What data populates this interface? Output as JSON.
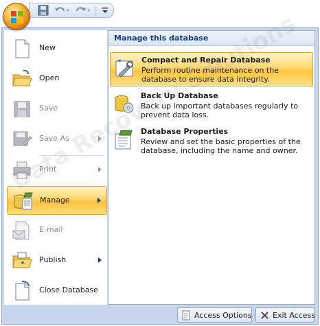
{
  "toolbar": {
    "icons": [
      "office-button-icon",
      "save-icon",
      "undo-icon",
      "redo-icon",
      "customize-icon"
    ]
  },
  "left_menu": {
    "items": [
      {
        "label": "New",
        "enabled": true,
        "has_submenu": false,
        "icon": "new-document-icon"
      },
      {
        "label": "Open",
        "enabled": true,
        "has_submenu": false,
        "icon": "open-folder-icon"
      },
      {
        "label": "Save",
        "enabled": false,
        "has_submenu": false,
        "icon": "save-icon"
      },
      {
        "label": "Save As",
        "enabled": false,
        "has_submenu": true,
        "icon": "save-as-icon"
      },
      {
        "label": "Print",
        "enabled": false,
        "has_submenu": true,
        "icon": "printer-icon"
      },
      {
        "label": "Manage",
        "enabled": true,
        "has_submenu": true,
        "selected": true,
        "icon": "manage-database-icon"
      },
      {
        "label": "E-mail",
        "enabled": false,
        "has_submenu": false,
        "icon": "email-icon"
      },
      {
        "label": "Publish",
        "enabled": true,
        "has_submenu": true,
        "icon": "publish-folder-icon"
      },
      {
        "label": "Close Database",
        "enabled": true,
        "has_submenu": false,
        "icon": "close-database-icon"
      }
    ]
  },
  "submenu": {
    "header": "Manage this database",
    "items": [
      {
        "title": "Compact and Repair Database",
        "description": "Perform routine maintenance on the database to ensure data integrity.",
        "selected": true,
        "icon": "compact-repair-icon"
      },
      {
        "title": "Back Up Database",
        "description": "Back up important databases regularly to prevent data loss.",
        "icon": "backup-database-icon"
      },
      {
        "title": "Database Properties",
        "description": "Review and set the basic properties of the database, including the name and owner.",
        "icon": "database-properties-icon"
      }
    ]
  },
  "footer": {
    "options_label": "Access Options",
    "exit_label": "Exit Access"
  },
  "watermark": "Data Recovery Solutions",
  "colors": {
    "highlight": "#ffc341",
    "header_text": "#15428b",
    "frame": "#c7d6ea",
    "disabled_text": "#8c8c8c"
  }
}
